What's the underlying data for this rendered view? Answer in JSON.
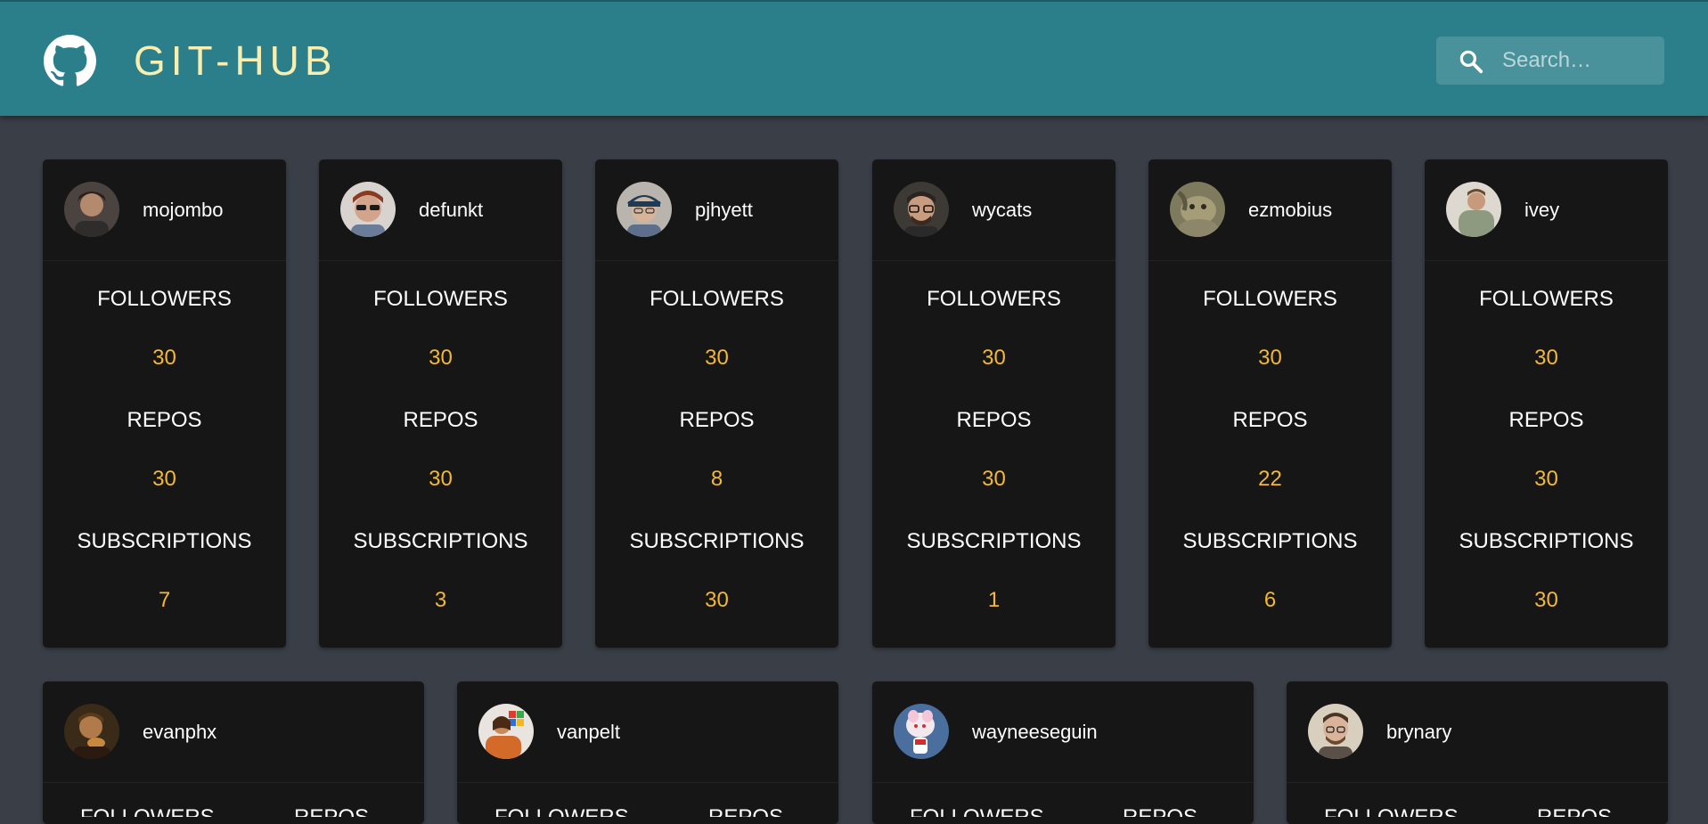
{
  "header": {
    "brand": "GIT-HUB",
    "logo_icon": "github-octocat-icon",
    "search_placeholder": "Search…",
    "search_icon": "search-icon",
    "colors": {
      "bar": "#2a7f8a",
      "brand_text": "#f7eeb0",
      "page_bg": "#3a3e47",
      "card_bg": "#161616",
      "value": "#f5b82e"
    }
  },
  "labels": {
    "followers": "FOLLOWERS",
    "repos": "REPOS",
    "subscriptions": "SUBSCRIPTIONS"
  },
  "users": [
    {
      "login": "mojombo",
      "followers": "30",
      "repos": "30",
      "subscriptions": "7"
    },
    {
      "login": "defunkt",
      "followers": "30",
      "repos": "30",
      "subscriptions": "3"
    },
    {
      "login": "pjhyett",
      "followers": "30",
      "repos": "8",
      "subscriptions": "30"
    },
    {
      "login": "wycats",
      "followers": "30",
      "repos": "30",
      "subscriptions": "1"
    },
    {
      "login": "ezmobius",
      "followers": "30",
      "repos": "22",
      "subscriptions": "6"
    },
    {
      "login": "ivey",
      "followers": "30",
      "repos": "30",
      "subscriptions": "30"
    }
  ],
  "users_row2": [
    {
      "login": "evanphx"
    },
    {
      "login": "vanpelt"
    },
    {
      "login": "wayneeseguin"
    },
    {
      "login": "brynary"
    }
  ]
}
